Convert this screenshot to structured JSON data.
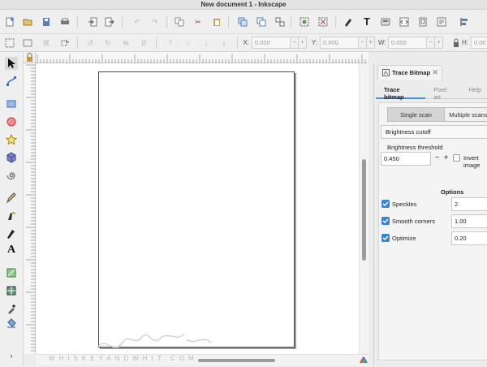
{
  "window": {
    "title": "New document 1 - Inkscape"
  },
  "toolbar": {
    "coords": [
      {
        "label": "X:",
        "value": "0.000"
      },
      {
        "label": "Y:",
        "value": "0.000"
      },
      {
        "label": "W:",
        "value": "0.000"
      },
      {
        "label": "H:",
        "value": "0.00"
      }
    ],
    "step_minus": "−",
    "step_plus": "+"
  },
  "watermark": "WHISKEYANDWHIT.COM",
  "panel": {
    "tab_title": "Trace Bitmap",
    "tab_close": "✕",
    "subtabs": [
      "Trace bitmap",
      "Pixel art",
      "Help"
    ],
    "modes": [
      "Single scan",
      "Multiple scans"
    ],
    "mode_select": "Brightness cutoff",
    "threshold_label": "Brightness threshold",
    "threshold_value": "0.450",
    "threshold_minus": "−",
    "threshold_plus": "+",
    "invert_label": "Invert image",
    "options_label": "Options",
    "options": [
      {
        "name": "Speckles",
        "value": "2",
        "checked": true
      },
      {
        "name": "Smooth corners",
        "value": "1.00",
        "checked": true
      },
      {
        "name": "Optimize",
        "value": "0.20",
        "checked": true
      }
    ]
  },
  "colors": {
    "accent": "#3a82d6",
    "tab_underline": "#4a90d9"
  }
}
